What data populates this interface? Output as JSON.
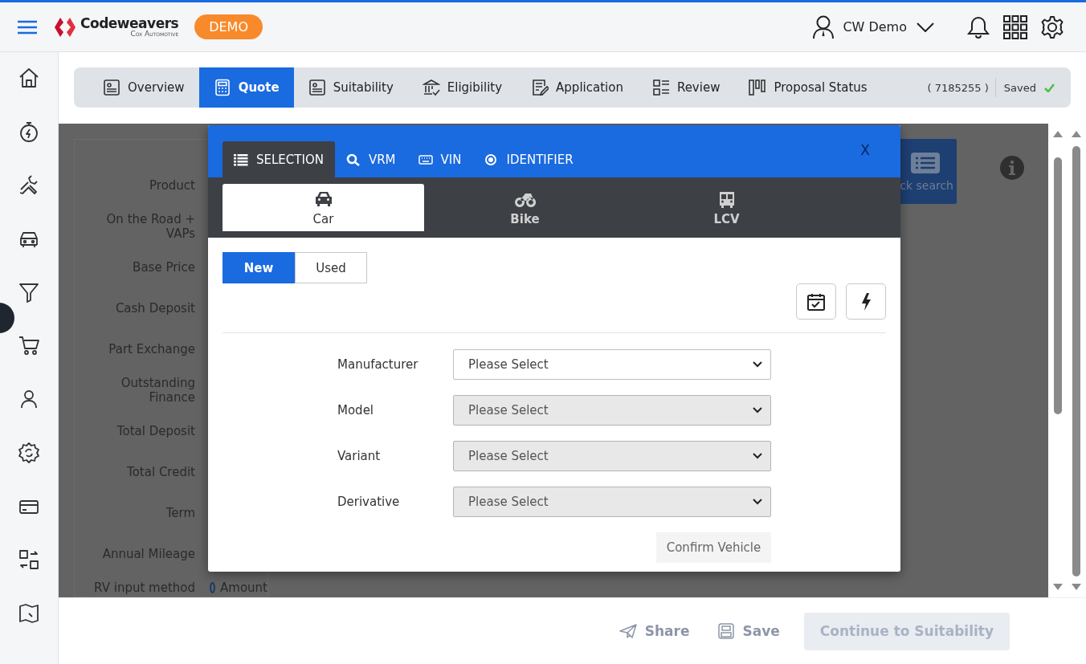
{
  "header": {
    "brand": "Codeweavers",
    "brand_sub": "Cox Automotive",
    "badge": "DEMO",
    "user": "CW Demo"
  },
  "tabs": [
    {
      "label": "Overview",
      "selected": false
    },
    {
      "label": "Quote",
      "selected": true
    },
    {
      "label": "Suitability",
      "selected": false
    },
    {
      "label": "Eligibility",
      "selected": false
    },
    {
      "label": "Application",
      "selected": false
    },
    {
      "label": "Review",
      "selected": false
    },
    {
      "label": "Proposal Status",
      "selected": false
    }
  ],
  "proposal_ref": "( 7185255 )",
  "save_status": "Saved",
  "form": {
    "fields": [
      {
        "kind": "value",
        "label": "Product"
      },
      {
        "kind": "value",
        "label": "On the Road + VAPs"
      },
      {
        "kind": "value",
        "label": "Base Price"
      },
      {
        "kind": "value",
        "label": "Cash Deposit"
      },
      {
        "kind": "value",
        "label": "Part Exchange"
      },
      {
        "kind": "value",
        "label": "Outstanding Finance"
      },
      {
        "kind": "value",
        "label": "Total Deposit"
      },
      {
        "kind": "value",
        "label": "Total Credit"
      },
      {
        "kind": "value",
        "label": "Term"
      },
      {
        "kind": "value",
        "label": "Annual Mileage"
      },
      {
        "kind": "radio",
        "label": "RV input method",
        "option": "Amount",
        "selected": true
      }
    ],
    "quick_search": "ck search"
  },
  "modal": {
    "search_tabs": [
      {
        "label": "SELECTION",
        "selected": true
      },
      {
        "label": "VRM",
        "selected": false
      },
      {
        "label": "VIN",
        "selected": false
      },
      {
        "label": "IDENTIFIER",
        "selected": false
      }
    ],
    "close": "X",
    "vehicle_types": [
      {
        "label": "Car",
        "selected": true
      },
      {
        "label": "Bike",
        "selected": false
      },
      {
        "label": "LCV",
        "selected": false
      }
    ],
    "conditions": [
      {
        "label": "New",
        "selected": true
      },
      {
        "label": "Used",
        "selected": false
      }
    ],
    "selects": [
      {
        "label": "Manufacturer",
        "placeholder": "Please Select",
        "disabled": false
      },
      {
        "label": "Model",
        "placeholder": "Please Select",
        "disabled": true
      },
      {
        "label": "Variant",
        "placeholder": "Please Select",
        "disabled": true
      },
      {
        "label": "Derivative",
        "placeholder": "Please Select",
        "disabled": true
      }
    ],
    "confirm": "Confirm Vehicle"
  },
  "footer": {
    "share": "Share",
    "save": "Save",
    "continue": {
      "label": "Continue to Suitability",
      "disabled": true
    }
  }
}
